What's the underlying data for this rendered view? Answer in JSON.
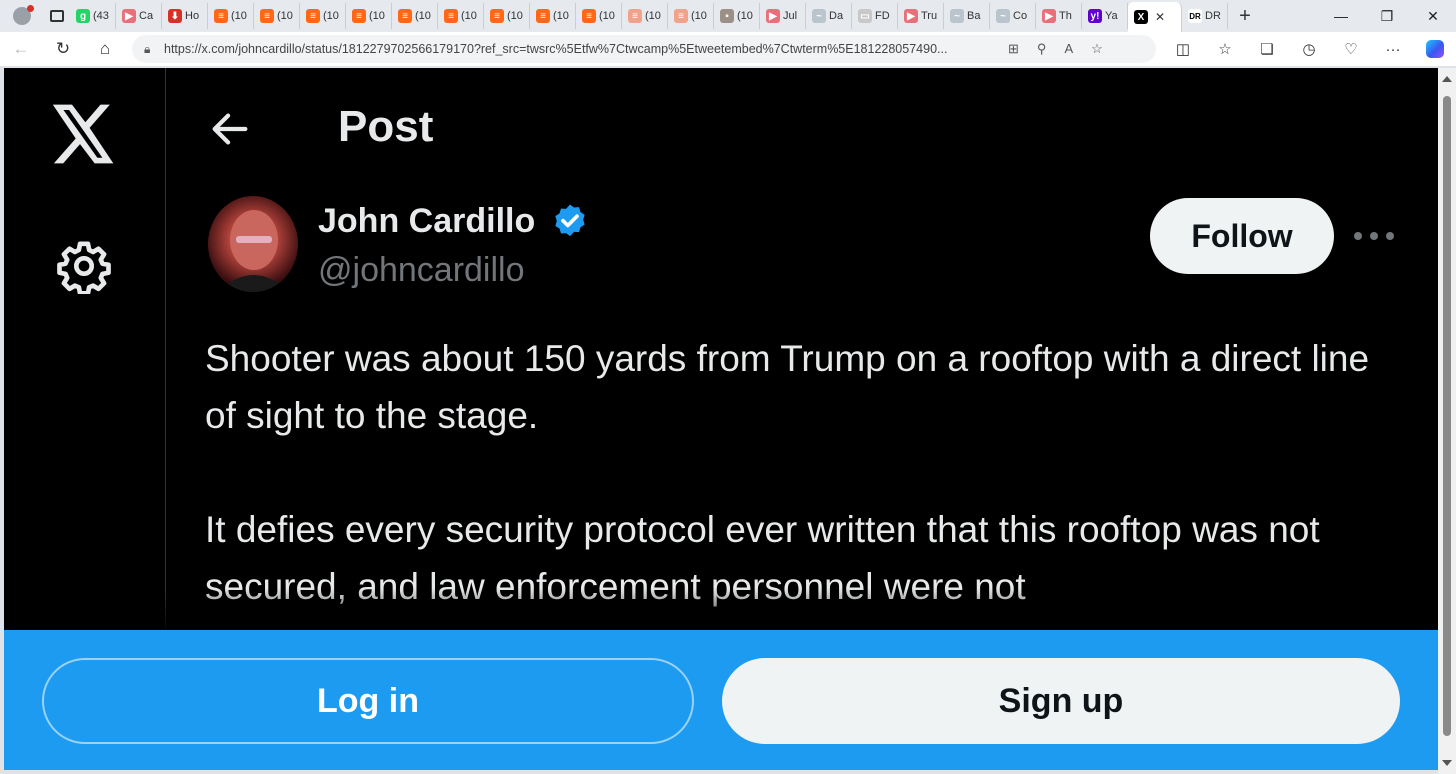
{
  "browser": {
    "tabs": [
      {
        "label": "(43",
        "color": "#25d366",
        "glyph": "g"
      },
      {
        "label": "Ca",
        "color": "#e8707b",
        "glyph": "▶"
      },
      {
        "label": "Ho",
        "color": "#d93025",
        "glyph": "⬇"
      },
      {
        "label": "(10",
        "color": "#ff6719",
        "glyph": "≡"
      },
      {
        "label": "(10",
        "color": "#ff6719",
        "glyph": "≡"
      },
      {
        "label": "(10",
        "color": "#ff6719",
        "glyph": "≡"
      },
      {
        "label": "(10",
        "color": "#ff6719",
        "glyph": "≡"
      },
      {
        "label": "(10",
        "color": "#ff6719",
        "glyph": "≡"
      },
      {
        "label": "(10",
        "color": "#ff6719",
        "glyph": "≡"
      },
      {
        "label": "(10",
        "color": "#ff6719",
        "glyph": "≡"
      },
      {
        "label": "(10",
        "color": "#ff6719",
        "glyph": "≡"
      },
      {
        "label": "(10",
        "color": "#ff6719",
        "glyph": "≡"
      },
      {
        "label": "(10",
        "color": "#f0a38a",
        "glyph": "≡"
      },
      {
        "label": "(10",
        "color": "#f0a38a",
        "glyph": "≡"
      },
      {
        "label": "(10",
        "color": "#9b8f86",
        "glyph": "▪"
      },
      {
        "label": "Jul",
        "color": "#e8707b",
        "glyph": "▶"
      },
      {
        "label": "Da",
        "color": "#b9c4cc",
        "glyph": "~"
      },
      {
        "label": "FD",
        "color": "#c8c8c8",
        "glyph": "▭"
      },
      {
        "label": "Tru",
        "color": "#e8707b",
        "glyph": "▶"
      },
      {
        "label": "Ba",
        "color": "#b9c4cc",
        "glyph": "~"
      },
      {
        "label": "Co",
        "color": "#b9c4cc",
        "glyph": "~"
      },
      {
        "label": "Th",
        "color": "#e8707b",
        "glyph": "▶"
      },
      {
        "label": "Ya",
        "color": "#6001d2",
        "glyph": "y!"
      }
    ],
    "active_tab": {
      "label": "",
      "glyph": "X"
    },
    "last_tab": {
      "label": "DR",
      "glyph": "DR"
    },
    "url": "https://x.com/johncardillo/status/1812279702566179170?ref_src=twsrc%5Etfw%7Ctwcamp%5Etweetembed%7Ctwterm%5E181228057490..."
  },
  "page": {
    "header_title": "Post",
    "author": {
      "name": "John Cardillo",
      "handle": "@johncardillo",
      "verified_color": "#1d9bf0"
    },
    "follow_label": "Follow",
    "tweet_text": "Shooter was about 150 yards from Trump on a rooftop with a direct line of sight to the stage.\n\nIt defies every security protocol ever written that this rooftop was not secured, and law enforcement personnel were not",
    "login_label": "Log in",
    "signup_label": "Sign up",
    "accent_color": "#1d9bf0"
  }
}
